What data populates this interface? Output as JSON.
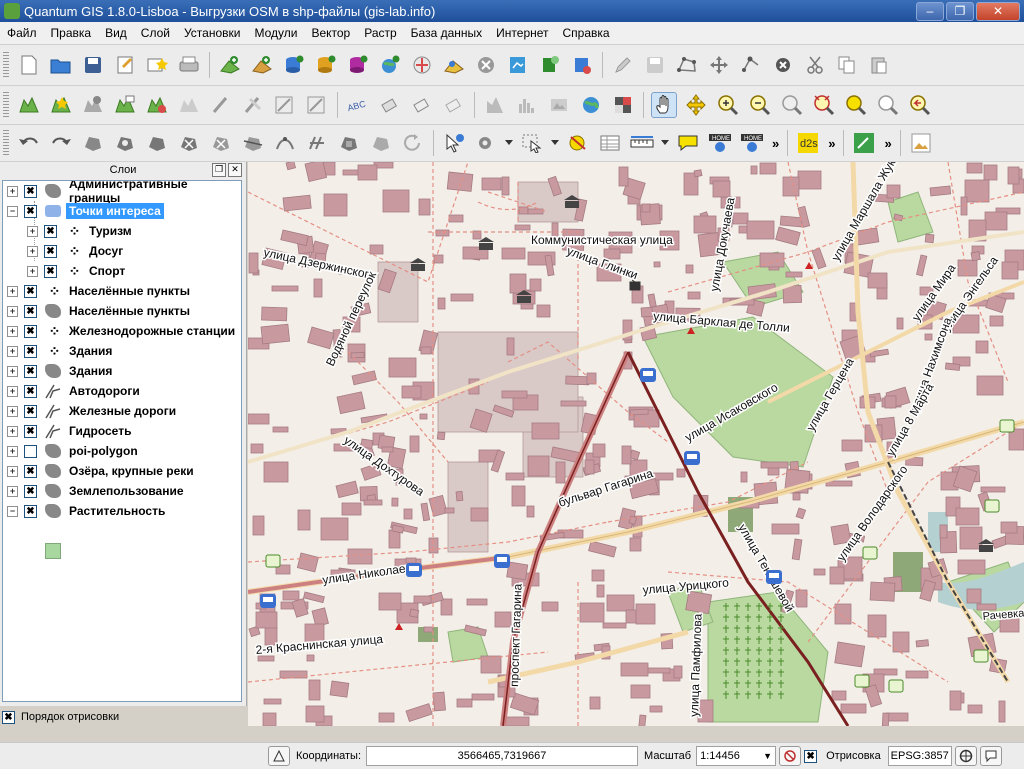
{
  "window": {
    "title": "Quantum GIS 1.8.0-Lisboa - Выгрузки OSM в shp-файлы (gis-lab.info)",
    "minimize": "–",
    "restore": "❐",
    "close": "✕"
  },
  "menu": [
    "Файл",
    "Правка",
    "Вид",
    "Слой",
    "Установки",
    "Модули",
    "Вектор",
    "Растр",
    "База данных",
    "Интернет",
    "Справка"
  ],
  "toolbar_more": "»",
  "layers_panel": {
    "title": "Слои",
    "float_button": "❐",
    "close_button": "✕",
    "layers": [
      {
        "name": "Административные границы",
        "checked": true,
        "expander": "+",
        "icon": "polygon-icon"
      },
      {
        "name": "Точки интереса",
        "checked": true,
        "expander": "−",
        "icon": "polygon-icon",
        "selected": true
      },
      {
        "name": "Туризм",
        "checked": true,
        "expander": "+",
        "icon": "points-icon",
        "child": true
      },
      {
        "name": "Досуг",
        "checked": true,
        "expander": "+",
        "icon": "points-icon",
        "child": true
      },
      {
        "name": "Спорт",
        "checked": true,
        "expander": "+",
        "icon": "points-icon",
        "child": true
      },
      {
        "name": "Населённые пункты",
        "checked": true,
        "expander": "+",
        "icon": "points-icon"
      },
      {
        "name": "Населённые пункты",
        "checked": true,
        "expander": "+",
        "icon": "polygon-icon"
      },
      {
        "name": "Железнодорожные станции",
        "checked": true,
        "expander": "+",
        "icon": "points-icon"
      },
      {
        "name": "Здания",
        "checked": true,
        "expander": "+",
        "icon": "points-icon"
      },
      {
        "name": "Здания",
        "checked": true,
        "expander": "+",
        "icon": "polygon-icon"
      },
      {
        "name": "Автодороги",
        "checked": true,
        "expander": "+",
        "icon": "line-icon"
      },
      {
        "name": "Железные дороги",
        "checked": true,
        "expander": "+",
        "icon": "line-icon"
      },
      {
        "name": "Гидросеть",
        "checked": true,
        "expander": "+",
        "icon": "line-icon"
      },
      {
        "name": "poi-polygon",
        "checked": false,
        "expander": "+",
        "icon": "polygon-icon"
      },
      {
        "name": "Озёра, крупные реки",
        "checked": true,
        "expander": "+",
        "icon": "polygon-icon"
      },
      {
        "name": "Землепользование",
        "checked": true,
        "expander": "+",
        "icon": "polygon-icon"
      },
      {
        "name": "Растительность",
        "checked": true,
        "expander": "−",
        "icon": "polygon-icon"
      }
    ],
    "render_order_label": "Порядок отрисовки",
    "render_order_checked": true
  },
  "map": {
    "street_labels": [
      "Коммунистическая улица",
      "улица Дзержинского",
      "улица Глинки",
      "улица Докучаева",
      "улица Маршала Жукова",
      "Водяной переулок",
      "улица Барклая де Толли",
      "улица Мира",
      "улица Энгельса",
      "улица Нахимсона",
      "улица Исаковского",
      "улица Герцена",
      "улица 8 Марта",
      "улица Дохтурова",
      "бульвар Гагарина",
      "улица Тенишевой",
      "улица Володарского",
      "улица Николаева",
      "проспект Гагарина",
      "улица Урицкого",
      "2-я Краснинская улица",
      "улица Памфилова",
      "Рачевка"
    ]
  },
  "statusbar": {
    "coords_label": "Координаты:",
    "coords_value": "3566465,7319667",
    "scale_label": "Масштаб",
    "scale_value": "1:14456",
    "render_label": "Отрисовка",
    "render_checked": true,
    "epsg": "EPSG:3857"
  },
  "colors": {
    "building": "#c89aa0",
    "road_dash": "#e58f84",
    "park": "#b9d9a0",
    "water": "#b5d0d0",
    "main_road": "#f3d9a8"
  }
}
